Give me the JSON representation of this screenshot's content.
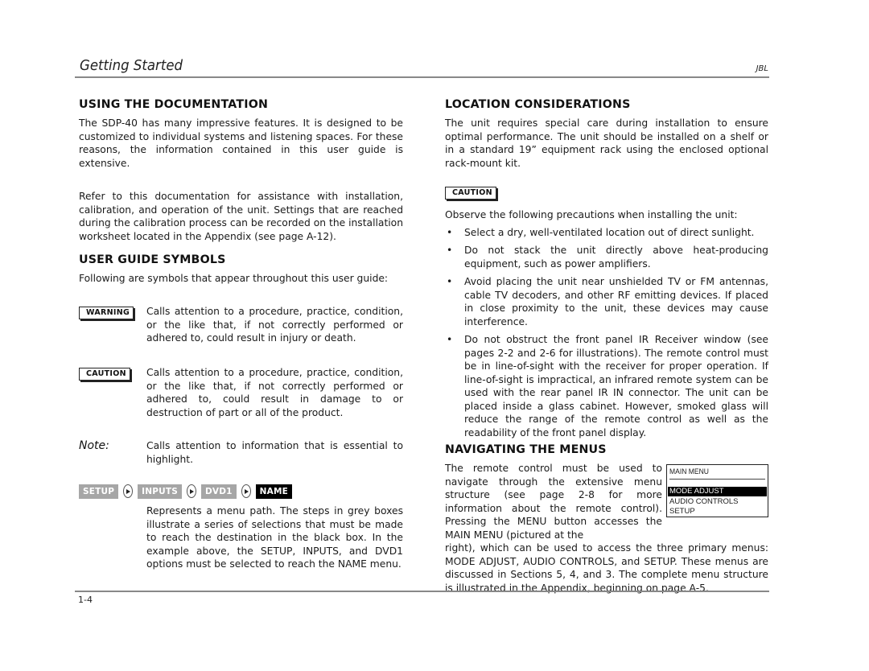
{
  "header": {
    "title": "Getting Started",
    "brand": "JBL"
  },
  "footer": {
    "page_number": "1-4"
  },
  "left": {
    "using_doc": {
      "heading": "USING THE DOCUMENTATION",
      "para1": "The SDP-40 has many impressive features. It is designed to be customized to individual systems and listening spaces. For these reasons, the information contained in this user guide is extensive.",
      "para2": "Refer to this documentation for assistance with installation, calibration, and operation of the unit. Settings that are reached during the calibration process can be recorded on the installation worksheet located in the Appendix (see page A-12)."
    },
    "symbols": {
      "heading": "USER GUIDE SYMBOLS",
      "intro": "Following are symbols that appear throughout this user guide:",
      "warning": {
        "badge": "WARNING",
        "text": "Calls attention to a procedure, practice, condition, or the like that, if not correctly performed or adhered to, could result in injury or death."
      },
      "caution": {
        "badge": "CAUTION",
        "text": "Calls attention to a procedure, practice, condition, or the like that, if not correctly performed or adhered to, could result in damage to or destruction of part or all of the product."
      },
      "note": {
        "label": "Note:",
        "text": "Calls attention to information that is essential to highlight."
      },
      "menu_path": {
        "steps": [
          "SETUP",
          "INPUTS",
          "DVD1"
        ],
        "destination": "NAME",
        "step_color": "#a6a6a6",
        "destination_color": "#000000",
        "text": "Represents a menu path. The steps in grey boxes illustrate a series of selections that must be made to reach the destination in the black box. In the example above, the SETUP, INPUTS, and DVD1 options must be selected to reach the NAME menu."
      }
    }
  },
  "right": {
    "location": {
      "heading": "LOCATION CONSIDERATIONS",
      "para1": "The unit requires special care during installation to ensure optimal performance. The unit should be installed on a shelf or in a standard 19” equipment rack using the enclosed optional rack-mount kit.",
      "caution_badge": "CAUTION",
      "intro": "Observe the following precautions when installing the unit:",
      "bullets": [
        "Select a dry, well-ventilated location out of direct sunlight.",
        "Do not stack the unit directly above heat-producing equipment, such as power amplifiers.",
        "Avoid placing the unit near unshielded TV or FM antennas, cable TV decoders, and other RF emitting devices. If placed in close proximity to the unit, these devices may cause interference.",
        "Do not obstruct the front panel IR Receiver window (see pages 2-2 and 2-6 for illustrations). The remote control must be in line-of-sight with the receiver for proper operation. If line-of-sight is impractical, an infrared remote system can be used with the rear panel IR IN connector. The unit can be placed inside a glass cabinet. However, smoked glass will reduce the range of the remote control as well as the readability of the front panel display."
      ]
    },
    "navigating": {
      "heading": "NAVIGATING THE MENUS",
      "para_wrap": "The remote control must be used to navigate through the extensive menu structure (see page 2-8 for more information about the remote control). Pressing the MENU button accesses the MAIN MENU (pictured at the",
      "para_full": "right), which can be used to access the three primary menus: MODE ADJUST, AUDIO CONTROLS, and SETUP. These menus are discussed in Sections 5, 4, and 3. The complete menu structure is illustrated in the Appendix, beginning on page A-5."
    },
    "main_menu": {
      "title": "MAIN MENU",
      "items": [
        "MODE ADJUST",
        "AUDIO CONTROLS",
        "SETUP"
      ],
      "selected_index": 0
    }
  }
}
